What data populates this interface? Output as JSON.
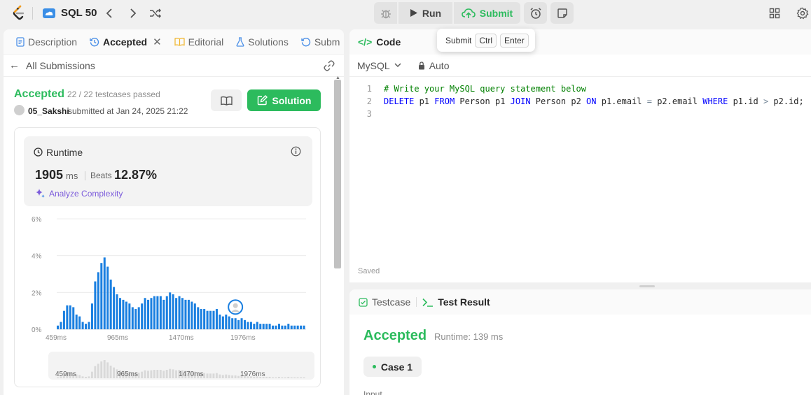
{
  "topbar": {
    "list_title": "SQL 50",
    "run_label": "Run",
    "submit_label": "Submit"
  },
  "tooltip": {
    "label": "Submit",
    "key1": "Ctrl",
    "key2": "Enter"
  },
  "left_tabs": [
    {
      "label": "Description"
    },
    {
      "label": "Accepted"
    },
    {
      "label": "Editorial"
    },
    {
      "label": "Solutions"
    },
    {
      "label": "Subm"
    }
  ],
  "submissions": {
    "back_label": "All Submissions",
    "status": "Accepted",
    "testcases": "22 / 22 testcases passed",
    "author": "05_Sakshi",
    "submitted_at": "submitted at Jan 24, 2025 21:22",
    "solution_label": "Solution"
  },
  "runtime": {
    "label": "Runtime",
    "value": "1905",
    "unit": "ms",
    "beats_label": "Beats",
    "beats_pct": "12.87%",
    "analyze_label": "Analyze Complexity"
  },
  "chart_data": {
    "type": "bar",
    "ylabel": "",
    "xlabel": "",
    "yticks": [
      "6%",
      "4%",
      "2%",
      "0%"
    ],
    "ylim": [
      0,
      6
    ],
    "xticks": [
      "459ms",
      "965ms",
      "1470ms",
      "1976ms"
    ],
    "values": [
      0.2,
      0.4,
      1.0,
      1.3,
      1.3,
      1.2,
      0.8,
      0.7,
      0.4,
      0.3,
      0.4,
      1.4,
      2.6,
      3.1,
      3.6,
      3.9,
      3.4,
      2.7,
      2.3,
      1.9,
      1.7,
      1.6,
      1.5,
      1.4,
      1.2,
      1.1,
      1.2,
      1.4,
      1.7,
      1.6,
      1.7,
      1.8,
      1.8,
      1.8,
      1.6,
      1.8,
      2.0,
      1.9,
      1.7,
      1.8,
      1.7,
      1.6,
      1.6,
      1.5,
      1.4,
      1.2,
      1.1,
      1.1,
      1.0,
      1.0,
      1.0,
      1.1,
      0.8,
      0.7,
      0.8,
      0.7,
      0.6,
      0.6,
      0.5,
      0.6,
      0.5,
      0.4,
      0.4,
      0.3,
      0.4,
      0.3,
      0.3,
      0.3,
      0.3,
      0.2,
      0.2,
      0.3,
      0.2,
      0.2,
      0.3,
      0.2,
      0.2,
      0.2,
      0.2,
      0.2
    ],
    "user_marker_index": 57,
    "mini_xticks": [
      "459ms",
      "965ms",
      "1470ms",
      "1976ms"
    ]
  },
  "code": {
    "header": "Code",
    "language": "MySQL",
    "mode": "Auto",
    "line_numbers": [
      "1",
      "2",
      "3"
    ],
    "line1": "# Write your MySQL query statement below",
    "line2": {
      "t1": "DELETE",
      "t2": " p1 ",
      "t3": "FROM",
      "t4": " Person p1 ",
      "t5": "JOIN",
      "t6": " Person p2 ",
      "t7": "ON",
      "t8": " p1.email ",
      "t9": "=",
      "t10": " p2.email ",
      "t11": "WHERE",
      "t12": " p1.id ",
      "t13": ">",
      "t14": " p2.id;"
    },
    "saved_label": "Saved"
  },
  "result": {
    "testcase_tab": "Testcase",
    "result_tab": "Test Result",
    "status": "Accepted",
    "runtime": "Runtime: 139 ms",
    "case_label": "Case 1",
    "input_label": "Input"
  },
  "colors": {
    "accent_green": "#2cbb5d",
    "bar_blue": "#1a7fe0",
    "purple": "#7c5cdb"
  }
}
